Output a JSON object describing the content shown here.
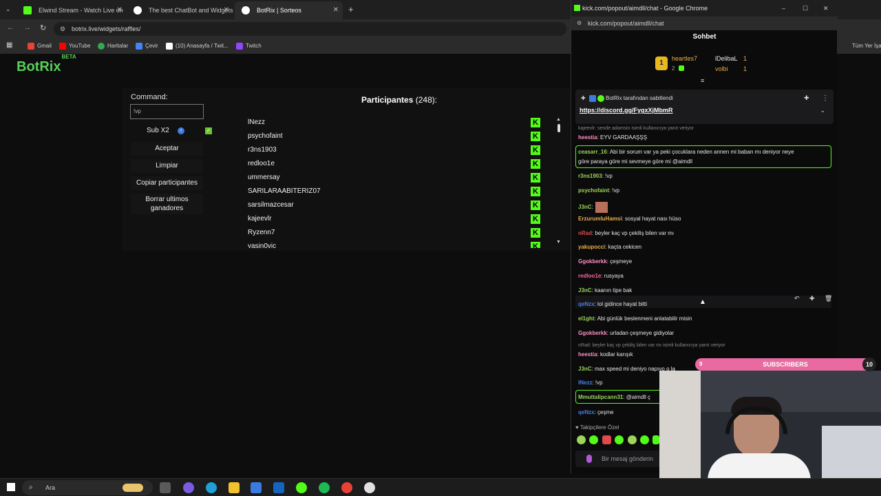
{
  "browser": {
    "tabs": [
      {
        "title": "Elwind Stream - Watch Live on",
        "color": "#53fc18"
      },
      {
        "title": "The best ChatBot and Widgets",
        "color": "#ffffff"
      },
      {
        "title": "BotRix | Sorteos",
        "color": "#ffffff"
      }
    ],
    "url": "botrix.live/widgets/raffles/",
    "bookmarks": [
      "Gmail",
      "YouTube",
      "Haritalar",
      "Çevir",
      "(10) Anasayfa / Twit...",
      "Twitch"
    ],
    "other_bookmarks": "Tüm Yer İşaretleri"
  },
  "botrix": {
    "logo": "BotRix",
    "logo_badge": "BETA",
    "command_label": "Command:",
    "command_value": "!vp",
    "sub_label": "Sub X2",
    "buttons": [
      "Aceptar",
      "Limpiar",
      "Copiar participantes",
      "Borrar ultimos ganadores"
    ],
    "participants_title": "Participantes",
    "participants_count": "(248):",
    "participants": [
      "lNezz",
      "psychofaint",
      "r3ns1903",
      "redloo1e",
      "ummersay",
      "SARILARAABITERIZ07",
      "sarsilmazcesar",
      "kajeevlr",
      "Ryzenn7",
      "yasin0vic"
    ]
  },
  "chat": {
    "window_title": "kick.com/popout/aimdll/chat - Google Chrome",
    "url": "kick.com/popout/aimdll/chat",
    "header": "Sohbet",
    "leaders": [
      {
        "rank": "1",
        "name": "heartles7",
        "count": "2"
      },
      {
        "name": "lDelibaL",
        "count": "1"
      },
      {
        "name": "volbi",
        "count": "1"
      }
    ],
    "pinned_by": "BotRix tarafından sabitlendi",
    "pinned_link": "https://discord.gg/FygxXjMbmR",
    "messages": [
      {
        "type": "reply",
        "text": "kajeevlr: sende adamsin isimli kullanıcıya yanıt veriyor"
      },
      {
        "user": "heestia",
        "color": "#ff8fc4",
        "text": ": EYV GARDAAŞŞŞ"
      },
      {
        "user": "ceasarr_16",
        "color": "#9bd55a",
        "text": ": Abi bir sorum var ya peki çocuklara neden annen mi baban mı deniyor neye"
      },
      {
        "user": "",
        "color": "#e8e8e8",
        "text": "göre paraya göre mi sevmeye göre mi @aimdll"
      },
      {
        "user": "r3ns1903",
        "color": "#9bd55a",
        "text": ": !vp"
      },
      {
        "user": "psychofaint",
        "color": "#9bd55a",
        "text": ": !vp"
      },
      {
        "user": "J3nC",
        "color": "#9bd55a",
        "text": ":"
      },
      {
        "user": "ErzurumluHamsi",
        "color": "#e8b04a",
        "text": ": sosyal hayat nası hüso"
      },
      {
        "user": "nRad",
        "color": "#e04a4a",
        "text": ": beyler kaç vp çekiliş bilen var mı"
      },
      {
        "user": "yakupocci",
        "color": "#e8b04a",
        "text": ": kaçta cekicen"
      },
      {
        "user": "Ggokberkk",
        "color": "#ff8fc4",
        "text": ": çeşmeye"
      },
      {
        "user": "redloo1e",
        "color": "#ff5fa0",
        "text": ": rusyaya"
      },
      {
        "user": "J3nC",
        "color": "#9bd55a",
        "text": ": kaanın tipe bak"
      },
      {
        "user": "qeNzx",
        "color": "#4a7ee8",
        "text": ": lol gidince hayat bitti"
      },
      {
        "user": "el1ght",
        "color": "#9bd55a",
        "text": ": Abi günlük beslenmeni anlatabilir misin"
      },
      {
        "user": "Ggokberkk",
        "color": "#ff8fc4",
        "text": ": urladan çeşmeye gidiyolar"
      },
      {
        "type": "reply",
        "text": "nRad: beyler kaç vp çekiliş bilen var mı isimli kullanıcıya yanıt veriyor"
      },
      {
        "user": "heestia",
        "color": "#ff8fc4",
        "text": ": kodlar karışık"
      },
      {
        "user": "J3nC",
        "color": "#9bd55a",
        "text": ": max speed mi deniyo napıyo o la"
      },
      {
        "user": "lNezz",
        "color": "#4a7ee8",
        "text": ": !vp"
      },
      {
        "user": "Mmuttalipcann31",
        "color": "#9bd55a",
        "text": ": @aimdll ç"
      },
      {
        "user": "qeNzx",
        "color": "#4a7ee8",
        "text": ": çeşme"
      }
    ],
    "followers_only": "Takipçilere Özel",
    "input_placeholder": "Bir mesaj gönderin"
  },
  "overlay": {
    "subs_left": "9",
    "subs_label": "SUBSCRIBERS",
    "subs_right": "10",
    "progress": 0.9
  },
  "taskbar": {
    "search": "Ara"
  }
}
